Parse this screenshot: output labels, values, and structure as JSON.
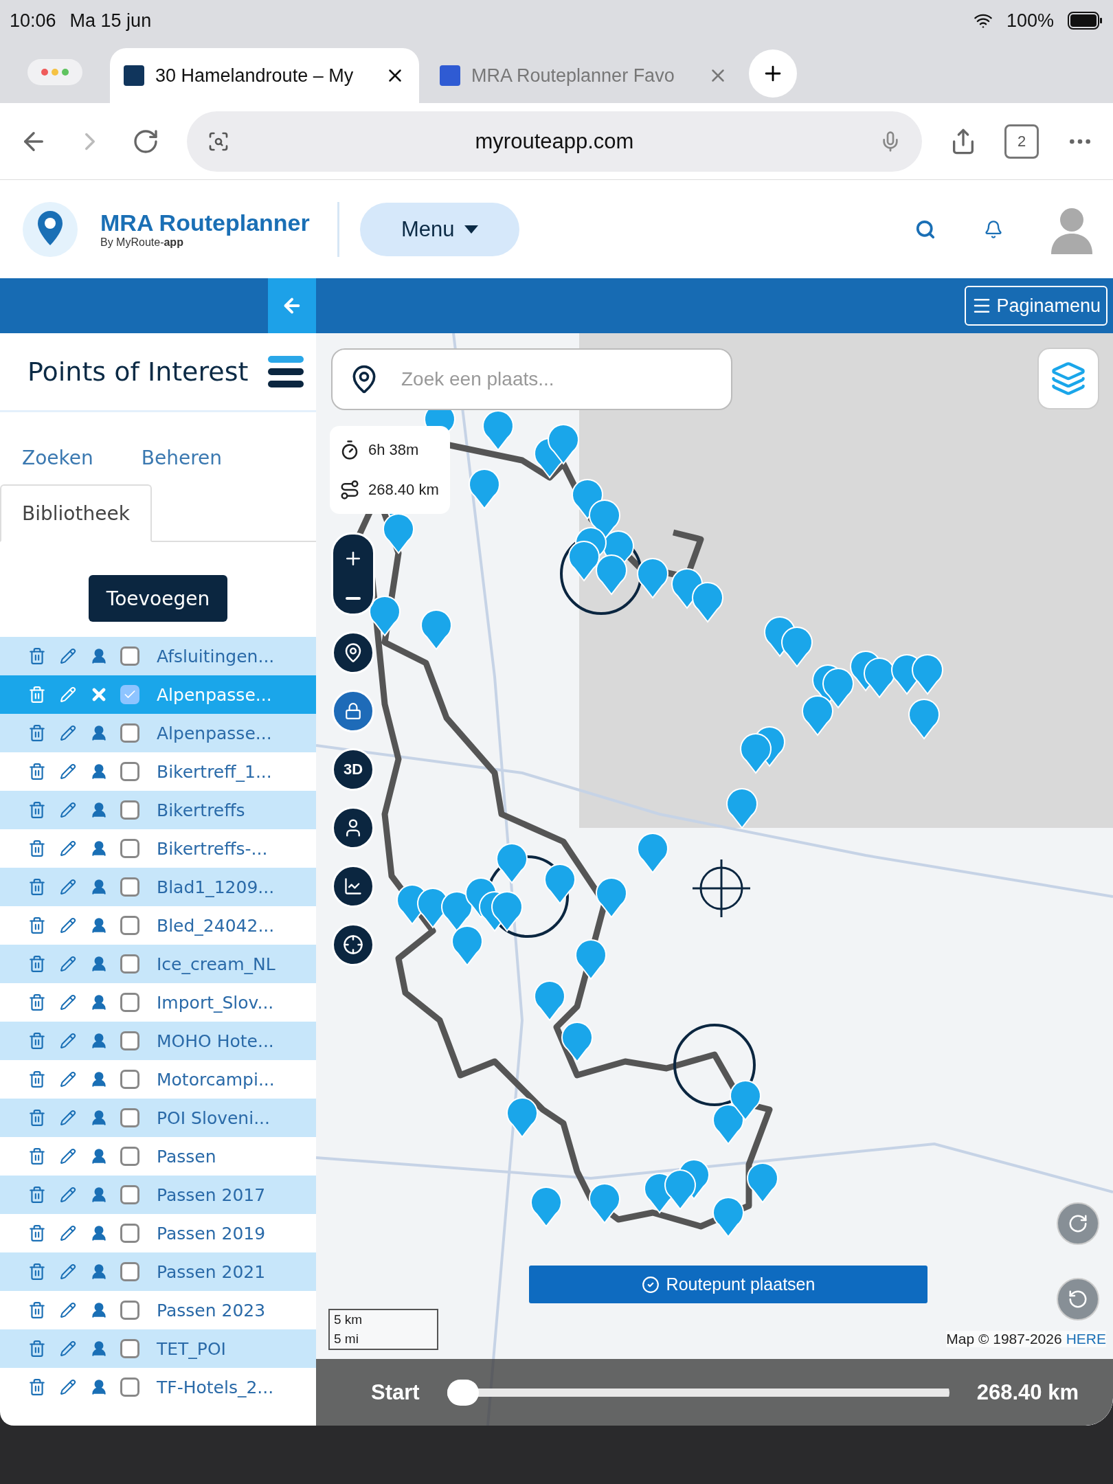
{
  "status_bar": {
    "time": "10:06",
    "date": "Ma 15 jun",
    "battery": "100%"
  },
  "browser_tabs": [
    {
      "title": "30 Hamelandroute – My",
      "selected": true
    },
    {
      "title": "MRA Routeplanner Favo",
      "selected": false
    }
  ],
  "address_bar": {
    "url": "myrouteapp.com",
    "tab_count": "2"
  },
  "header": {
    "logo_title": "MRA Routeplanner",
    "logo_subtitle": "By MyRoute-**app**",
    "menu": "Menu"
  },
  "page_menu": "Paginamenu",
  "sidebar": {
    "title": "Points of Interest",
    "tabs": [
      {
        "label": "Zoeken",
        "selected": false
      },
      {
        "label": "Beheren",
        "selected": false
      },
      {
        "label": "Bibliotheek",
        "selected": true
      }
    ],
    "add_button": "Toevoegen",
    "items": [
      {
        "name": "Afsluitingen...",
        "checked": false,
        "selected": false
      },
      {
        "name": "Alpenpasse...",
        "checked": true,
        "selected": true
      },
      {
        "name": "Alpenpasse...",
        "checked": false,
        "selected": false
      },
      {
        "name": "Bikertreff_1...",
        "checked": false,
        "selected": false
      },
      {
        "name": "Bikertreffs",
        "checked": false,
        "selected": false
      },
      {
        "name": "Bikertreffs-...",
        "checked": false,
        "selected": false
      },
      {
        "name": "Blad1_1209...",
        "checked": false,
        "selected": false
      },
      {
        "name": "Bled_24042...",
        "checked": false,
        "selected": false
      },
      {
        "name": "Ice_cream_NL",
        "checked": false,
        "selected": false
      },
      {
        "name": "Import_Slov...",
        "checked": false,
        "selected": false
      },
      {
        "name": "MOHO Hote...",
        "checked": false,
        "selected": false
      },
      {
        "name": "Motorcampi...",
        "checked": false,
        "selected": false
      },
      {
        "name": "POI Sloveni...",
        "checked": false,
        "selected": false
      },
      {
        "name": "Passen",
        "checked": false,
        "selected": false
      },
      {
        "name": "Passen 2017",
        "checked": false,
        "selected": false
      },
      {
        "name": "Passen 2019",
        "checked": false,
        "selected": false
      },
      {
        "name": "Passen 2021",
        "checked": false,
        "selected": false
      },
      {
        "name": "Passen 2023",
        "checked": false,
        "selected": false
      },
      {
        "name": "TET_POI",
        "checked": false,
        "selected": false
      },
      {
        "name": "TF-Hotels_2...",
        "checked": false,
        "selected": false
      }
    ]
  },
  "map": {
    "search": {
      "placeholder": "Zoek een plaats..."
    },
    "route_stats": {
      "duration": "6h 38m",
      "distance": "268.40 km"
    },
    "controls": [
      {
        "kind": "zoom"
      },
      {
        "kind": "add"
      },
      {
        "kind": "lock",
        "selected": true
      },
      {
        "kind": "label",
        "label": "3D"
      },
      {
        "kind": "person"
      },
      {
        "kind": "chart"
      },
      {
        "kind": "target"
      }
    ],
    "place_button": "Routepunt plaatsen",
    "scale": {
      "metric": "5 km",
      "imperial": "5 mi"
    },
    "copyright": "Map © 1987-2026",
    "copyright_link": "HERE",
    "slider": {
      "start": "Start",
      "end": "268.40 km",
      "level": 0.0
    }
  }
}
